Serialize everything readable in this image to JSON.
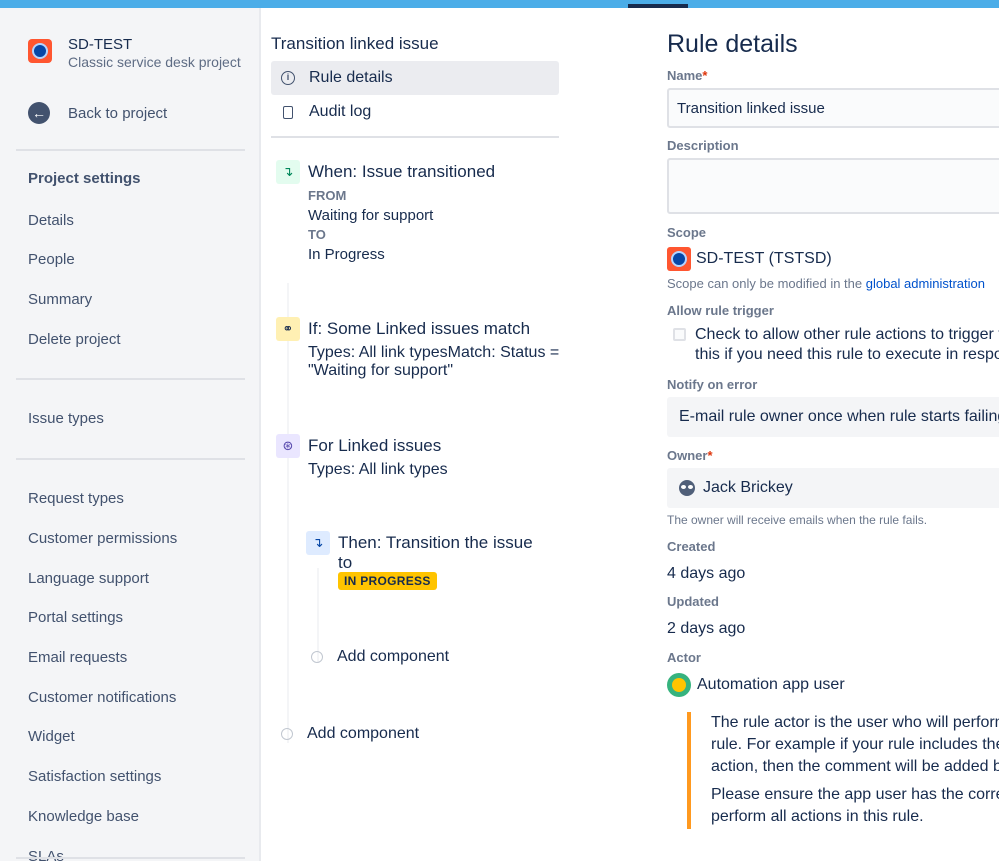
{
  "project": {
    "name": "SD-TEST",
    "type": "Classic service desk project",
    "back_label": "Back to project"
  },
  "sidebar": {
    "heading": "Project settings",
    "group1": [
      "Details",
      "People",
      "Summary",
      "Delete project"
    ],
    "group2": [
      "Issue types"
    ],
    "group3": [
      "Request types",
      "Customer permissions",
      "Language support",
      "Portal settings",
      "Email requests",
      "Customer notifications",
      "Widget",
      "Satisfaction settings",
      "Knowledge base",
      "SLAs"
    ]
  },
  "rule_nav": {
    "title": "Transition linked issue",
    "items": [
      "Rule details",
      "Audit log"
    ]
  },
  "components": {
    "trigger": {
      "title": "When: Issue transitioned",
      "from_label": "FROM",
      "from_value": "Waiting for support",
      "to_label": "TO",
      "to_value": "In Progress"
    },
    "condition": {
      "title": "If: Some Linked issues match",
      "line1": "Types: All link typesMatch: Status =",
      "line2": "\"Waiting for support\""
    },
    "branch": {
      "title": "For Linked issues",
      "line1": "Types: All link types"
    },
    "action": {
      "title_line1": "Then: Transition the issue",
      "title_line2": "to",
      "status": "IN PROGRESS"
    },
    "add_inner": "Add component",
    "add_outer": "Add component"
  },
  "details": {
    "title": "Rule details",
    "name_label": "Name",
    "name_value": "Transition linked issue",
    "description_label": "Description",
    "description_value": "",
    "scope_label": "Scope",
    "scope_value": "SD-TEST (TSTSD)",
    "scope_note": "Scope can only be modified in the ",
    "scope_link": "global administration",
    "allow_label": "Allow rule trigger",
    "allow_line1": "Check to allow other rule actions to trigger th",
    "allow_line2": "this if you need this rule to execute in respon",
    "notify_label": "Notify on error",
    "notify_value": "E-mail rule owner once when rule starts failing a",
    "owner_label": "Owner",
    "owner_value": "Jack Brickey",
    "owner_help": "The owner will receive emails when the rule fails.",
    "created_label": "Created",
    "created_value": "4 days ago",
    "updated_label": "Updated",
    "updated_value": "2 days ago",
    "actor_label": "Actor",
    "actor_value": "Automation app user",
    "note_lines": [
      "The rule actor is the user who will perform",
      "rule. For example if your rule includes the '",
      "action, then the comment will be added by",
      "Please ensure the app user has the correct",
      "perform all actions in this rule."
    ]
  },
  "colors": {
    "topbar": "#4bade8",
    "status_lozenge": "#ffc400",
    "note_border": "#ff991f",
    "link": "#0052cc"
  }
}
